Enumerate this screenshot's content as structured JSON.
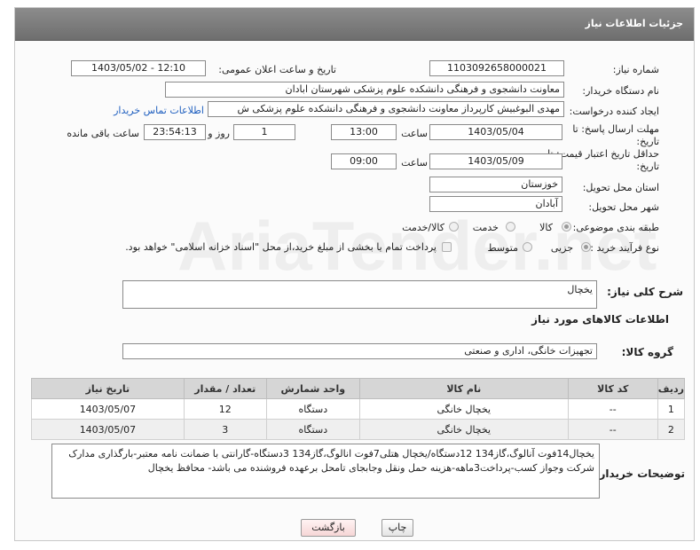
{
  "header": {
    "title": "جزئیات اطلاعات نیاز"
  },
  "form": {
    "need_number": {
      "label": "شماره نیاز:",
      "value": "1103092658000021"
    },
    "announce_datetime": {
      "label": "تاریخ و ساعت اعلان عمومی:",
      "value": "1403/05/02 - 12:10"
    },
    "buyer_org": {
      "label": "نام دستگاه خریدار:",
      "value": "معاونت دانشجوی و فرهنگی دانشکده علوم پزشکی شهرستان ابادان"
    },
    "requester": {
      "label": "ایجاد کننده درخواست:",
      "value": "مهدی البوغبیش کارپرداز معاونت دانشجوی و فرهنگی دانشکده علوم پزشکی ش",
      "contact_link": "اطلاعات تماس خریدار"
    },
    "reply_deadline": {
      "label": "مهلت ارسال پاسخ: تا تاریخ:",
      "date": "1403/05/04",
      "time_label": "ساعت",
      "time": "13:00",
      "days": "1",
      "days_label": "روز و",
      "remaining": "23:54:13",
      "remaining_label": "ساعت باقی مانده"
    },
    "price_validity": {
      "label": "حداقل تاریخ اعتبار قیمت: تا تاریخ:",
      "date": "1403/05/09",
      "time_label": "ساعت",
      "time": "09:00"
    },
    "province": {
      "label": "استان محل تحویل:",
      "value": "خوزستان"
    },
    "city": {
      "label": "شهر محل تحویل:",
      "value": "آبادان"
    },
    "category": {
      "label": "طبقه بندی موضوعی:",
      "options": [
        "کالا",
        "خدمت",
        "کالا/خدمت"
      ]
    },
    "purchase_type": {
      "label": "نوع فرآیند خرید :",
      "options": [
        "جزیی",
        "متوسط"
      ],
      "note": "پرداخت تمام یا بخشی از مبلغ خرید،از محل \"اسناد خزانه اسلامی\" خواهد بود."
    }
  },
  "summary": {
    "label": "شرح کلی نیاز:",
    "value": "یخچال"
  },
  "goods_section": {
    "title": "اطلاعات کالاهای مورد نیاز"
  },
  "goods_group": {
    "label": "گروه کالا:",
    "value": "تجهیزات خانگی، اداری و صنعتی"
  },
  "table": {
    "headers": [
      "ردیف",
      "کد کالا",
      "نام کالا",
      "واحد شمارش",
      "تعداد / مقدار",
      "تاریخ نیاز"
    ],
    "rows": [
      [
        "1",
        "--",
        "یخچال خانگی",
        "دستگاه",
        "12",
        "1403/05/07"
      ],
      [
        "2",
        "--",
        "یخچال خانگی",
        "دستگاه",
        "3",
        "1403/05/07"
      ]
    ]
  },
  "buyer_notes": {
    "label": "توضیحات خریدار:",
    "value": "یخچال14فوت آنالوگ،گاز134    12دستگاه/یخچال هتلی7فوت انالوگ،گاز134    3دستگاه-گارانتی با ضمانت نامه معتبر-بارگذاری مدارک شرکت وجواز کسب-پرداخت3ماهه-هزینه حمل ونقل وجابجای تامحل برعهده فروشنده می باشد- محافظ یخچال"
  },
  "buttons": {
    "print": "چاپ",
    "back": "بازگشت"
  },
  "watermark": {
    "text": "AriaTender.net"
  },
  "colors": {
    "header_bg": "#7d7d7d",
    "link": "#1f5fbf",
    "table_header_bg": "#d6d6d6",
    "back_button_bg": "#fde2e2"
  }
}
